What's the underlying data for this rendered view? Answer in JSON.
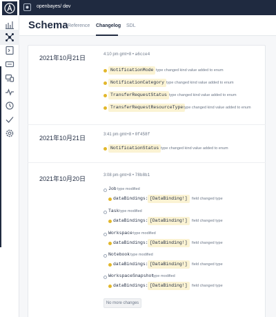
{
  "app": {
    "graph_name": "openbayes/ dev",
    "graph_badge_icon": "graph-icon"
  },
  "sidebar": {
    "items": [
      {
        "icon": "home-icon"
      },
      {
        "icon": "schema-icon",
        "active": true
      },
      {
        "icon": "explorer-icon"
      },
      {
        "icon": "operations-icon"
      },
      {
        "icon": "clients-icon"
      },
      {
        "icon": "checks-icon"
      },
      {
        "icon": "history-icon"
      },
      {
        "icon": "launches-icon"
      },
      {
        "icon": "settings-icon"
      }
    ]
  },
  "header": {
    "title": "Schema",
    "tabs": [
      {
        "label": "Reference",
        "active": false
      },
      {
        "label": "Changelog",
        "active": true
      },
      {
        "label": "SDL",
        "active": false
      }
    ]
  },
  "changelog": {
    "entries": [
      {
        "date": "2021年10月21日",
        "time": "4:10 pm gmt+8",
        "hash": "a6cce4",
        "changes": [
          {
            "name": "NotificationMode",
            "desc": "type changed kind  value added to enum"
          },
          {
            "name": "NotificationCategory",
            "desc": "type changed kind  value added to enum"
          },
          {
            "name": "TransferRequestStatus",
            "desc": "type changed kind  value added to enum"
          },
          {
            "name": "TransferRequestResourceType",
            "desc": "type changed kind  value added to enum"
          }
        ]
      },
      {
        "date": "2021年10月21日",
        "time": "3:41 pm gmt+8",
        "hash": "0f458f",
        "changes": [
          {
            "name": "NotificationStatus",
            "desc": "type changed kind  value added to enum"
          }
        ]
      },
      {
        "date": "2021年10月20日",
        "time": "3:08 pm gmt+8",
        "hash": "78b8b1",
        "types": [
          {
            "name": "Job",
            "status": "type modified",
            "field": "dataBindings:",
            "field_type": "[DataBinding!]",
            "change": "field changed type"
          },
          {
            "name": "Task",
            "status": "type modified",
            "field": "dataBindings:",
            "field_type": "[DataBinding!]",
            "change": "field changed type"
          },
          {
            "name": "Workspace",
            "status": "type modified",
            "field": "dataBindings:",
            "field_type": "[DataBinding!]",
            "change": "field changed type"
          },
          {
            "name": "Notebook",
            "status": "type modified",
            "field": "dataBindings:",
            "field_type": "[DataBinding!]",
            "change": "field changed type"
          },
          {
            "name": "WorkspaceSnapshot",
            "status": "type modified",
            "field": "dataBindings:",
            "field_type": "[DataBinding!]",
            "change": "field changed type"
          }
        ]
      }
    ],
    "no_more_label": "No more changes"
  },
  "colors": {
    "brand_dark": "#1f2a40",
    "chip_bg": "#fbf3d3",
    "dot": "#e2b72b"
  }
}
